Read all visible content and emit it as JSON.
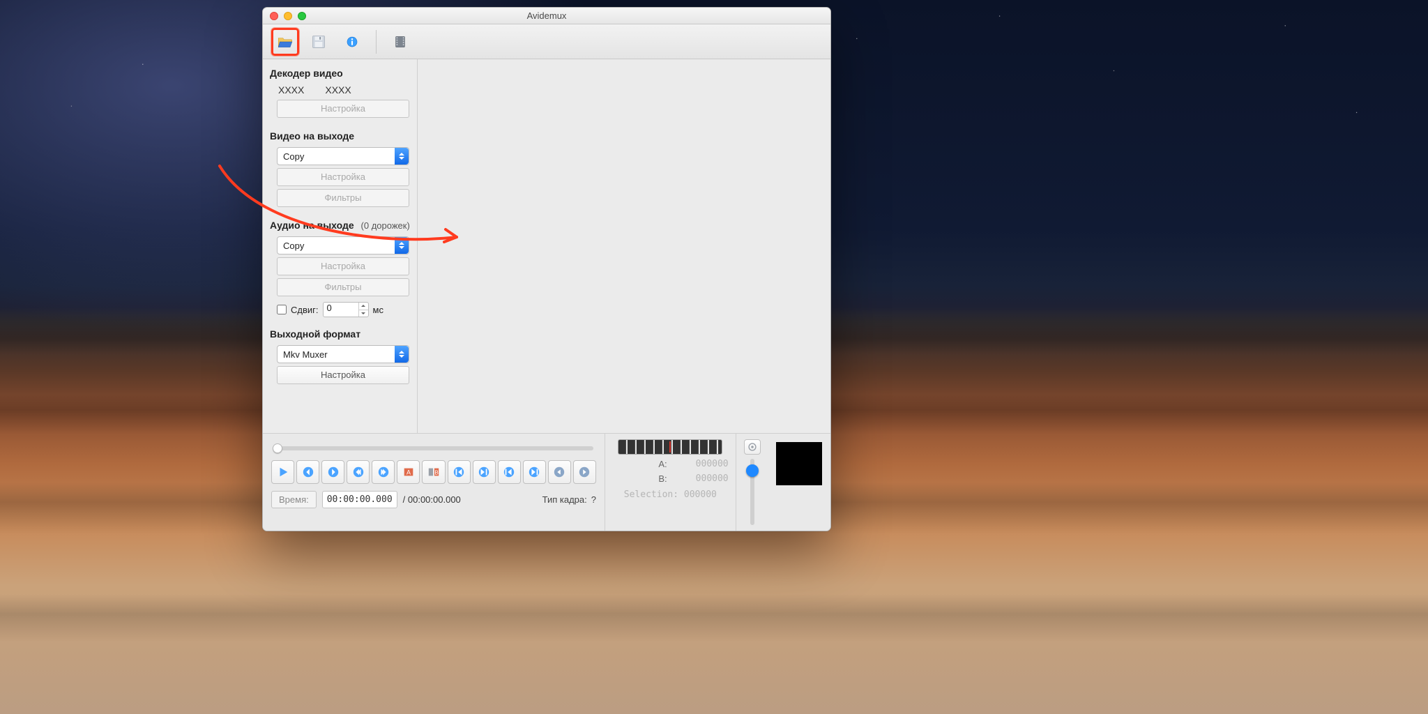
{
  "window": {
    "title": "Avidemux"
  },
  "toolbar": {
    "open_highlighted": true,
    "icons": [
      "open-folder-icon",
      "save-floppy-icon",
      "info-icon",
      "film-clip-icon"
    ]
  },
  "sidebar": {
    "decoder": {
      "title": "Декодер видео",
      "val1": "XXXX",
      "val2": "XXXX",
      "configure": "Настройка"
    },
    "video_out": {
      "title": "Видео на выходе",
      "codec": "Copy",
      "configure": "Настройка",
      "filters": "Фильтры"
    },
    "audio_out": {
      "title": "Аудио на выходе",
      "tracks_note": "(0 дорожек)",
      "codec": "Copy",
      "configure": "Настройка",
      "filters": "Фильтры",
      "shift_label": "Сдвиг:",
      "shift_value": "0",
      "shift_unit": "мс"
    },
    "output_format": {
      "title": "Выходной формат",
      "muxer": "Mkv Muxer",
      "configure": "Настройка"
    }
  },
  "transport": {
    "time_label": "Время:",
    "time_value": "00:00:00.000",
    "total_value": "/ 00:00:00.000",
    "frame_type_label": "Тип кадра:",
    "frame_type_value": "?",
    "ab": {
      "a_label": "A:",
      "a_value": "000000",
      "b_label": "B:",
      "b_value": "000000",
      "selection_label": "Selection:",
      "selection_value": "000000"
    }
  },
  "annotation": {
    "color": "#ff3b1f"
  }
}
